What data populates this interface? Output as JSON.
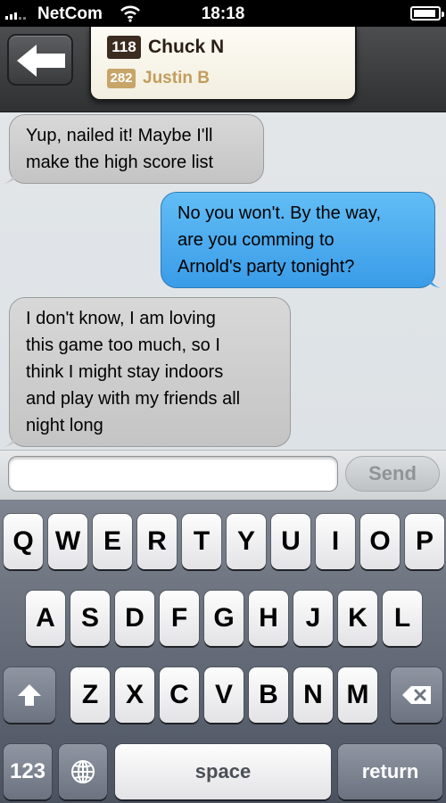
{
  "status_bar": {
    "carrier": "NetCom",
    "time": "18:18",
    "icons": [
      "signal-bars-icon",
      "wifi-icon",
      "battery-icon"
    ]
  },
  "header": {
    "back_icon": "back-arrow-icon",
    "players": [
      {
        "score": "118",
        "name": "Chuck N",
        "color": "#3b2c20"
      },
      {
        "score": "282",
        "name": "Justin B",
        "color": "#c7a569"
      }
    ]
  },
  "messages": [
    {
      "direction": "incoming",
      "lines": [
        "Yup, nailed it! Maybe I'll",
        "make the high score list"
      ]
    },
    {
      "direction": "outgoing",
      "lines": [
        "No you won't. By the way,",
        "are you comming to",
        "Arnold's party tonight?"
      ]
    },
    {
      "direction": "incoming",
      "lines": [
        "I don't know, I am loving",
        "this game too much, so I",
        "think I might stay indoors",
        "and play with my friends all",
        "night long"
      ]
    }
  ],
  "composer": {
    "input_value": "",
    "input_placeholder": "",
    "send_label": "Send"
  },
  "keyboard": {
    "row1": [
      "Q",
      "W",
      "E",
      "R",
      "T",
      "Y",
      "U",
      "I",
      "O",
      "P"
    ],
    "row2": [
      "A",
      "S",
      "D",
      "F",
      "G",
      "H",
      "J",
      "K",
      "L"
    ],
    "row3": [
      "Z",
      "X",
      "C",
      "V",
      "B",
      "N",
      "M"
    ],
    "shift_icon": "shift-arrow-icon",
    "delete_icon": "delete-backspace-icon",
    "globe_icon": "globe-icon",
    "numbers_label": "123",
    "space_label": "space",
    "return_label": "return"
  },
  "colors": {
    "outgoing_bubble": "#4aaaf0",
    "incoming_bubble": "#cfcfcf",
    "chat_background": "#e0e4e7"
  }
}
